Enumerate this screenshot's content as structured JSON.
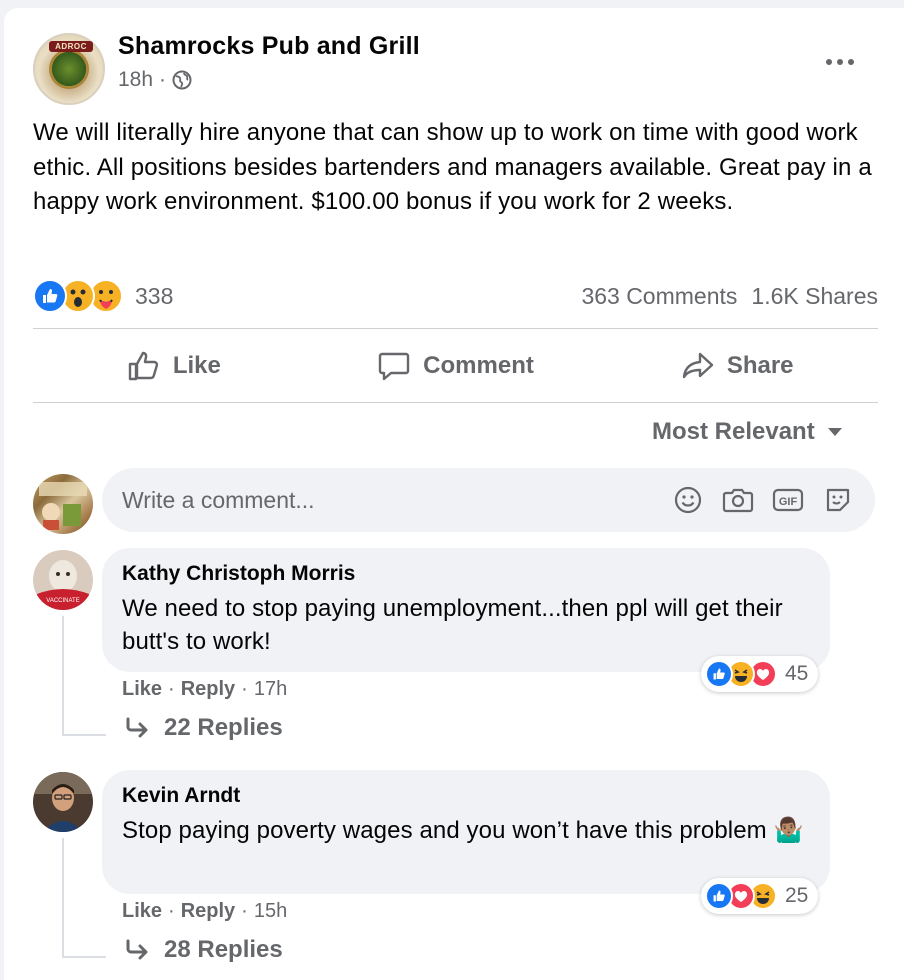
{
  "post": {
    "page_name": "Shamrocks Pub and Grill",
    "avatar_banner_text": "ADROC",
    "time": "18h",
    "separator": "·",
    "text": "We will literally hire anyone that can show up to work on time with good work ethic. All positions besides bartenders and managers available. Great pay in a happy work environment. $100.00 bonus if you work for 2 weeks.",
    "reaction_icons": [
      "like-icon",
      "wow-icon",
      "care-icon"
    ],
    "reaction_count": "338",
    "comments_count": "363 Comments",
    "shares_count": "1.6K Shares"
  },
  "actions": {
    "like": "Like",
    "comment": "Comment",
    "share": "Share"
  },
  "sort": {
    "label": "Most Relevant"
  },
  "composer": {
    "placeholder": "Write a comment..."
  },
  "comments": [
    {
      "author": "Kathy Christoph Morris",
      "text": "We need to stop paying unemployment...then ppl will get their butt's to work!",
      "like": "Like",
      "reply": "Reply",
      "time": "17h",
      "reaction_icons": [
        "like-icon",
        "haha-icon",
        "love-icon"
      ],
      "reaction_count": "45",
      "replies": "22 Replies"
    },
    {
      "author": "Kevin Arndt",
      "text": "Stop paying poverty wages and you won’t have this problem 🤷🏽‍♂️",
      "like": "Like",
      "reply": "Reply",
      "time": "15h",
      "reaction_icons": [
        "like-icon",
        "love-icon",
        "haha-icon"
      ],
      "reaction_count": "25",
      "replies": "28 Replies"
    }
  ],
  "colors": {
    "fb_blue": "#1877f2",
    "secondary_text": "#65676b",
    "bubble_bg": "#f0f2f5",
    "love_red": "#f33e58",
    "emoji_yellow": "#f7b125"
  }
}
